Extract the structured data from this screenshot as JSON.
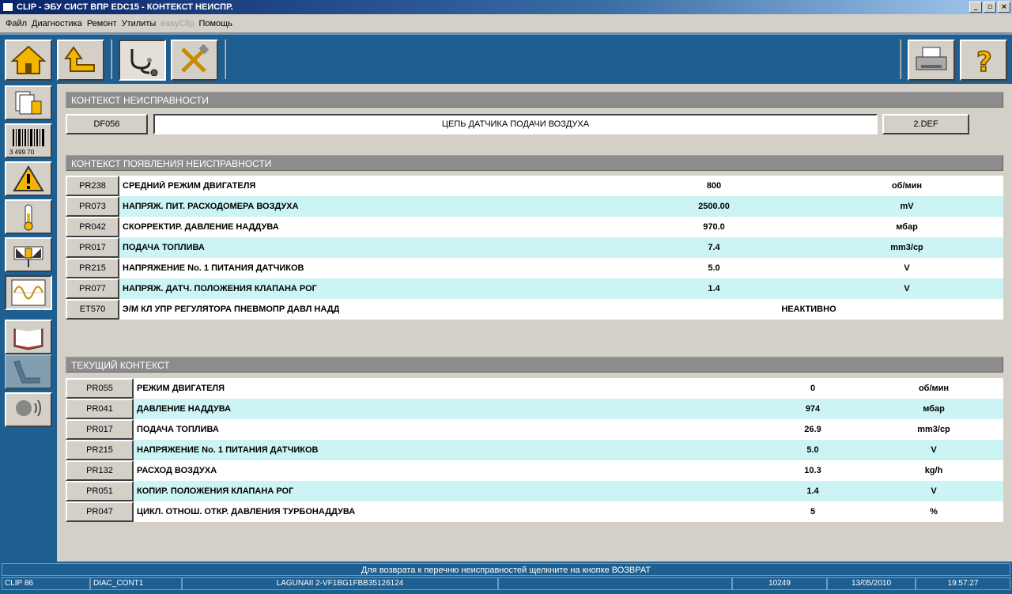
{
  "window": {
    "title": "CLIP - ЭБУ СИСТ ВПР EDC15 - КОНТЕКСТ НЕИСПР.",
    "min": "_",
    "max": "▫",
    "close": "×"
  },
  "menu": [
    {
      "label": "Файл",
      "disabled": false
    },
    {
      "label": "Диагностика",
      "disabled": false
    },
    {
      "label": "Ремонт",
      "disabled": false
    },
    {
      "label": "Утилиты",
      "disabled": false
    },
    {
      "label": "easyClip",
      "disabled": true
    },
    {
      "label": "Помощь",
      "disabled": false
    }
  ],
  "toolbar": {
    "left": [
      "home-icon",
      "up-arrow-icon",
      "stethoscope-icon",
      "tools-icon"
    ],
    "right": [
      "printer-icon",
      "help-icon"
    ]
  },
  "sidebar": [
    "documents-icon",
    "barcode-icon",
    "warning-icon",
    "thermometer-icon",
    "actuator-icon",
    "oscilloscope-icon",
    "manual-book-icon",
    "seat-icon",
    "voice-icon"
  ],
  "barcode_text": "3 499 70",
  "fault_context": {
    "header": "КОНТЕКСТ НЕИСПРАВНОСТИ",
    "code": "DF056",
    "description": "ЦЕПЬ ДАТЧИКА ПОДАЧИ ВОЗДУХА",
    "status": "2.DEF"
  },
  "appearance_context": {
    "header": "КОНТЕКСТ ПОЯВЛЕНИЯ НЕИСПРАВНОСТИ",
    "rows": [
      {
        "code": "PR238",
        "label": "СРЕДНИЙ РЕЖИМ ДВИГАТЕЛЯ",
        "value": "800",
        "unit": "об/мин"
      },
      {
        "code": "PR073",
        "label": "НАПРЯЖ. ПИТ. РАСХОДОМЕРА ВОЗДУХА",
        "value": "2500.00",
        "unit": "mV"
      },
      {
        "code": "PR042",
        "label": "СКОРРЕКТИР. ДАВЛЕНИЕ НАДДУВА",
        "value": "970.0",
        "unit": "мбар"
      },
      {
        "code": "PR017",
        "label": "ПОДАЧА ТОПЛИВА",
        "value": "7.4",
        "unit": "mm3/cp"
      },
      {
        "code": "PR215",
        "label": "НАПРЯЖЕНИЕ No. 1 ПИТАНИЯ ДАТЧИКОВ",
        "value": "5.0",
        "unit": "V"
      },
      {
        "code": "PR077",
        "label": "НАПРЯЖ. ДАТЧ. ПОЛОЖЕНИЯ КЛАПАНА РОГ",
        "value": "1.4",
        "unit": "V"
      },
      {
        "code": "ET570",
        "label": "Э/М КЛ УПР РЕГУЛЯТОРА ПНЕВМОПР ДАВЛ НАДД",
        "value": "НЕАКТИВНО",
        "unit": ""
      }
    ]
  },
  "current_context": {
    "header": "ТЕКУЩИЙ КОНТЕКСТ",
    "rows": [
      {
        "code": "PR055",
        "label": "РЕЖИМ ДВИГАТЕЛЯ",
        "value": "0",
        "unit": "об/мин"
      },
      {
        "code": "PR041",
        "label": "ДАВЛЕНИЕ НАДДУВА",
        "value": "974",
        "unit": "мбар"
      },
      {
        "code": "PR017",
        "label": "ПОДАЧА ТОПЛИВА",
        "value": "26.9",
        "unit": "mm3/cp"
      },
      {
        "code": "PR215",
        "label": "НАПРЯЖЕНИЕ No. 1 ПИТАНИЯ ДАТЧИКОВ",
        "value": "5.0",
        "unit": "V"
      },
      {
        "code": "PR132",
        "label": "РАСХОД ВОЗДУХА",
        "value": "10.3",
        "unit": "kg/h"
      },
      {
        "code": "PR051",
        "label": "КОПИР. ПОЛОЖЕНИЯ КЛАПАНА РОГ",
        "value": "1.4",
        "unit": "V"
      },
      {
        "code": "PR047",
        "label": "ЦИКЛ. ОТНОШ. ОТКР. ДАВЛЕНИЯ ТУРБОНАДДУВА",
        "value": "5",
        "unit": "%"
      }
    ]
  },
  "statusbar": {
    "message": "Для возврата к перечню неисправностей щелкните на кнопке ВОЗВРАТ",
    "clip": "CLIP 86",
    "screen": "DIAC_CONT1",
    "vehicle": "LAGUNAII 2-VF1BG1FBB35126124",
    "blank": "",
    "code": "10249",
    "date": "13/05/2010",
    "time": "19:57:27"
  }
}
